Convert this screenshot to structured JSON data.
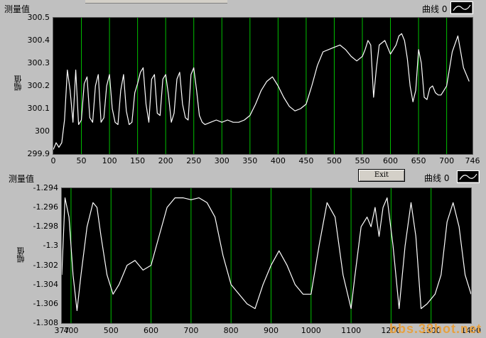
{
  "top_chart": {
    "title": "测量值",
    "legend": "曲线 0",
    "ylabel": "幅值",
    "yticks": [
      "300.5",
      "300.4",
      "300.3",
      "300.2",
      "300.1",
      "300",
      "299.9"
    ],
    "xticks": [
      "0",
      "50",
      "100",
      "150",
      "200",
      "250",
      "300",
      "350",
      "400",
      "450",
      "500",
      "550",
      "600",
      "650",
      "700",
      "746"
    ]
  },
  "bottom_chart": {
    "title": "测量值",
    "legend": "曲线 0",
    "ylabel": "幅值",
    "exit_label": "Exit",
    "yticks": [
      "-1.294",
      "-1.296",
      "-1.298",
      "-1.3",
      "-1.302",
      "-1.304",
      "-1.306",
      "-1.308"
    ],
    "xticks": [
      "377",
      "400",
      "500",
      "600",
      "700",
      "800",
      "900",
      "1000",
      "1100",
      "1200",
      "1300",
      "1400"
    ]
  },
  "watermark": "bbs.38hot.net",
  "colors": {
    "plot_bg": "#000000",
    "trace": "#ffffff",
    "grid": "#00c000",
    "panel": "#c0c0c0"
  },
  "chart_data": [
    {
      "type": "line",
      "title": "测量值",
      "ylabel": "幅值",
      "xlim": [
        0,
        746
      ],
      "ylim": [
        299.9,
        300.5
      ],
      "grid": "vertical green lines at x ticks",
      "x": [
        0,
        5,
        10,
        15,
        20,
        25,
        30,
        35,
        40,
        45,
        50,
        55,
        60,
        65,
        70,
        75,
        80,
        85,
        90,
        95,
        100,
        105,
        110,
        115,
        120,
        125,
        130,
        135,
        140,
        145,
        150,
        155,
        160,
        165,
        170,
        175,
        180,
        185,
        190,
        195,
        200,
        205,
        210,
        215,
        220,
        225,
        230,
        235,
        240,
        245,
        250,
        255,
        260,
        265,
        270,
        280,
        290,
        300,
        310,
        320,
        330,
        340,
        350,
        360,
        370,
        380,
        390,
        400,
        410,
        420,
        430,
        440,
        450,
        460,
        470,
        480,
        490,
        500,
        510,
        520,
        530,
        540,
        550,
        555,
        560,
        565,
        570,
        575,
        580,
        590,
        600,
        610,
        615,
        620,
        625,
        630,
        635,
        640,
        645,
        650,
        655,
        660,
        665,
        670,
        675,
        680,
        685,
        690,
        695,
        700,
        710,
        720,
        725,
        730,
        740
      ],
      "y": [
        299.92,
        299.95,
        299.93,
        299.95,
        300.05,
        300.27,
        300.18,
        300.04,
        300.27,
        300.03,
        300.05,
        300.21,
        300.24,
        300.06,
        300.04,
        300.2,
        300.25,
        300.04,
        300.06,
        300.2,
        300.25,
        300.1,
        300.04,
        300.03,
        300.18,
        300.25,
        300.09,
        300.03,
        300.04,
        300.17,
        300.21,
        300.26,
        300.28,
        300.12,
        300.04,
        300.23,
        300.25,
        300.08,
        300.07,
        300.23,
        300.25,
        300.16,
        300.04,
        300.08,
        300.23,
        300.26,
        300.12,
        300.06,
        300.05,
        300.25,
        300.28,
        300.18,
        300.07,
        300.04,
        300.03,
        300.04,
        300.05,
        300.04,
        300.05,
        300.04,
        300.04,
        300.05,
        300.07,
        300.12,
        300.18,
        300.22,
        300.24,
        300.2,
        300.15,
        300.11,
        300.09,
        300.1,
        300.12,
        300.2,
        300.29,
        300.35,
        300.36,
        300.37,
        300.38,
        300.36,
        300.33,
        300.31,
        300.33,
        300.36,
        300.4,
        300.38,
        300.15,
        300.28,
        300.38,
        300.4,
        300.34,
        300.38,
        300.42,
        300.43,
        300.4,
        300.32,
        300.2,
        300.13,
        300.18,
        300.36,
        300.3,
        300.15,
        300.14,
        300.19,
        300.2,
        300.17,
        300.16,
        300.16,
        300.18,
        300.2,
        300.35,
        300.42,
        300.35,
        300.28,
        300.22
      ]
    },
    {
      "type": "line",
      "title": "测量值",
      "ylabel": "幅值",
      "xlim": [
        377,
        1400
      ],
      "ylim": [
        -1.308,
        -1.294
      ],
      "grid": "vertical green lines at x ticks",
      "x": [
        377,
        385,
        395,
        405,
        415,
        425,
        440,
        455,
        465,
        475,
        490,
        505,
        520,
        540,
        560,
        580,
        600,
        620,
        640,
        660,
        680,
        700,
        720,
        740,
        760,
        780,
        800,
        820,
        840,
        860,
        880,
        900,
        920,
        940,
        960,
        980,
        1000,
        1020,
        1040,
        1060,
        1080,
        1100,
        1110,
        1125,
        1140,
        1150,
        1160,
        1170,
        1180,
        1190,
        1205,
        1220,
        1235,
        1250,
        1262,
        1275,
        1290,
        1310,
        1325,
        1340,
        1355,
        1370,
        1385,
        1400
      ],
      "y": [
        -1.303,
        -1.295,
        -1.297,
        -1.303,
        -1.3067,
        -1.303,
        -1.298,
        -1.2955,
        -1.296,
        -1.299,
        -1.303,
        -1.305,
        -1.304,
        -1.302,
        -1.3015,
        -1.3025,
        -1.302,
        -1.299,
        -1.296,
        -1.295,
        -1.295,
        -1.2952,
        -1.295,
        -1.2955,
        -1.297,
        -1.301,
        -1.304,
        -1.305,
        -1.306,
        -1.3065,
        -1.304,
        -1.302,
        -1.3005,
        -1.302,
        -1.304,
        -1.305,
        -1.305,
        -1.3,
        -1.2955,
        -1.297,
        -1.303,
        -1.3065,
        -1.303,
        -1.298,
        -1.297,
        -1.298,
        -1.296,
        -1.299,
        -1.296,
        -1.295,
        -1.3,
        -1.3065,
        -1.3,
        -1.2955,
        -1.299,
        -1.3065,
        -1.306,
        -1.305,
        -1.303,
        -1.2975,
        -1.2955,
        -1.298,
        -1.303,
        -1.305
      ]
    }
  ]
}
